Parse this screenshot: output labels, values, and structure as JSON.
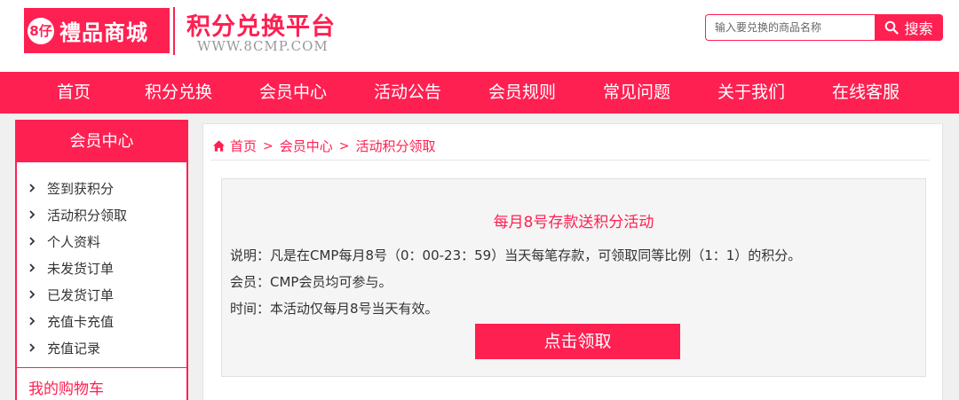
{
  "header": {
    "logo_badge": "8仔",
    "logo_name": "禮品商城",
    "platform_title": "积分兑换平台",
    "platform_url": "WWW.8CMP.COM",
    "search_placeholder": "输入要兑换的商品名称",
    "search_button": "搜索",
    "brand_color": "#ff2052"
  },
  "nav": {
    "items": [
      "首页",
      "积分兑换",
      "会员中心",
      "活动公告",
      "会员规则",
      "常见问题",
      "关于我们",
      "在线客服"
    ]
  },
  "sidebar": {
    "title": "会员中心",
    "items": [
      "签到获积分",
      "活动积分领取",
      "个人资料",
      "未发货订单",
      "已发货订单",
      "充值卡充值",
      "充值记录"
    ],
    "cart": "我的购物车"
  },
  "breadcrumb": {
    "items": [
      "首页",
      "会员中心",
      "活动积分领取"
    ],
    "separator": ">"
  },
  "activity": {
    "title": "每月8号存款送积分活动",
    "lines": [
      "说明：凡是在CMP每月8号（0：00-23：59）当天每笔存款，可领取同等比例（1：1）的积分。",
      "会员：CMP会员均可参与。",
      "时间：本活动仅每月8号当天有效。"
    ],
    "button": "点击领取"
  }
}
